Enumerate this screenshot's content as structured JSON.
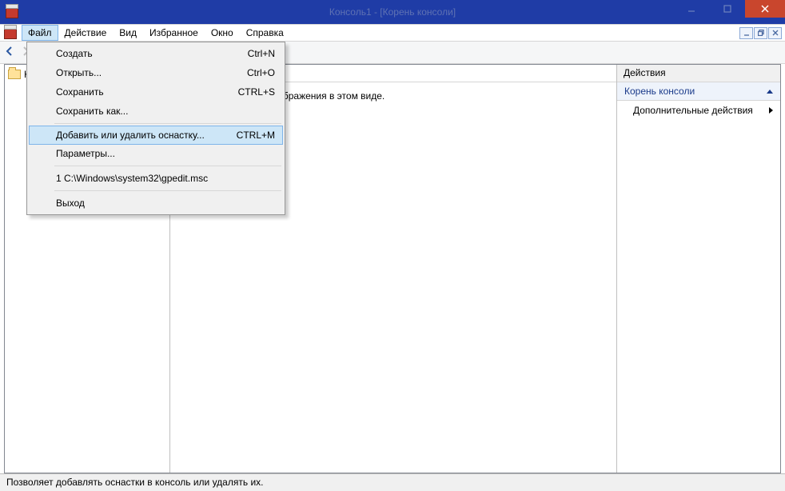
{
  "titlebar": {
    "title": "Консоль1 - [Корень консоли]"
  },
  "menubar": {
    "file": "Файл",
    "action": "Действие",
    "view": "Вид",
    "favorites": "Избранное",
    "window": "Окно",
    "help": "Справка"
  },
  "dropdown": {
    "create": {
      "label": "Создать",
      "shortcut": "Ctrl+N"
    },
    "open": {
      "label": "Открыть...",
      "shortcut": "Ctrl+O"
    },
    "save": {
      "label": "Сохранить",
      "shortcut": "CTRL+S"
    },
    "save_as": {
      "label": "Сохранить как..."
    },
    "add_remove": {
      "label": "Добавить или удалить оснастку...",
      "shortcut": "CTRL+M"
    },
    "options": {
      "label": "Параметры..."
    },
    "recent": {
      "label": "1 C:\\Windows\\system32\\gpedit.msc"
    },
    "exit": {
      "label": "Выход"
    }
  },
  "tree": {
    "root": "Корень консоли"
  },
  "content": {
    "empty": "Нет элементов для отображения в этом виде."
  },
  "actions": {
    "title": "Действия",
    "section": "Корень консоли",
    "more": "Дополнительные действия"
  },
  "statusbar": {
    "text": "Позволяет добавлять оснастки в консоль или удалять их."
  }
}
